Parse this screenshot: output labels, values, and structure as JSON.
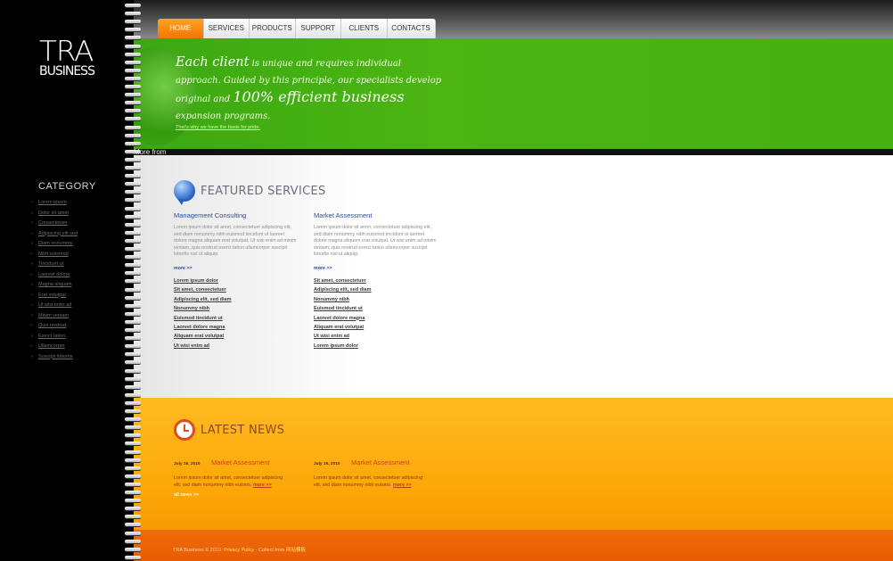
{
  "logo": {
    "line1": "TRA",
    "line2": "BUSINESS"
  },
  "nav": {
    "tabs": [
      "HOME",
      "SERVICES",
      "PRODUCTS",
      "SUPPORT",
      "CLIENTS",
      "CONTACTS"
    ],
    "active": "HOME"
  },
  "hero": {
    "lead": "Each client",
    "text1": "is unique and requires individual approach. Guided by this principle, our specialists develop original and",
    "highlight": "100% efficient business",
    "text2": "expansion programs.",
    "link": "That's why we have the basis for pride.",
    "more_from": "More from"
  },
  "sidebar": {
    "category_title": "CATEGORY",
    "items": [
      "Lorem ipsum",
      "Dolor sit amet",
      "Consectetuer",
      "Adipiscing elit sed",
      "Diam nonummy",
      "Nibh euismod",
      "Tincidunt ut",
      "Laoreet dolore",
      "Magna aliquam",
      "Erat volutpat",
      "Ut wisi enim ad",
      "Minim veniam",
      "Quis nostrud",
      "Exerci tation",
      "Ullamcorper",
      "Suscipit lobortis"
    ]
  },
  "featured": {
    "title": "FEATURED SERVICES",
    "columns": [
      {
        "heading": "Management Consulting",
        "body": "Lorem ipsum dolor sit amet, consectetuer adipiscing elit, sed diam nonummy nibh euismod tincidunt ut laoreet dolore magna aliquam erat volutpat. Ut wisi enim ad minim veniam, quis nostrud exerci tation ullamcorper suscipit lobortis nisl ut aliquip.",
        "more": "more >>",
        "links": [
          "Lorem ipsum dolor",
          "Sit amet, consectetuer",
          "Adipiscing elit, sed diam",
          "Nonummy nibh",
          "Euismod tincidunt ut",
          "Laoreet dolore magna",
          "Aliquam erat volutpat",
          "Ut wisi enim ad"
        ]
      },
      {
        "heading": "Market Assessment",
        "body": "Lorem ipsum dolor sit amet, consectetuer adipiscing elit, sed diam nonummy nibh euismod tincidunt ut laoreet dolore magna aliquam erat volutpat. Ut wisi enim ad minim veniam, quis nostrud exerci tation ullamcorper suscipit lobortis nisl ut aliquip.",
        "more": "more >>",
        "links": [
          "Sit amet, consectetuer",
          "Adipiscing elit, sed diam",
          "Nonummy nibh",
          "Euismod tincidunt ut",
          "Laoreet dolore magna",
          "Aliquam erat volutpat",
          "Ut wisi enim ad",
          "Lorem ipsum dolor"
        ]
      }
    ]
  },
  "news": {
    "title": "LATEST NEWS",
    "items": [
      {
        "date": "July 16, 2010",
        "title": "Market Assessment",
        "body": "Lorem ipsum dolor sit amet, consectetuer adipiscing elit, sed diam nonummy nibh euismo.",
        "more": "more >>"
      },
      {
        "date": "July 16, 2010",
        "title": "Market Assessment",
        "body": "Lorem ipsum dolor sit amet, consectetuer adipiscing elit, sed diam nonummy nibh euismo.",
        "more": "more >>"
      }
    ],
    "all_news": "all news >>"
  },
  "footer": {
    "copyright": "TRA Business © 2010",
    "privacy": "Privacy Policy",
    "collect": "Collect from",
    "source": "网站模板"
  },
  "colors": {
    "green": "#4cb512",
    "orange": "#fca707",
    "footer": "#e85c04",
    "nav_active": "#f47406"
  }
}
